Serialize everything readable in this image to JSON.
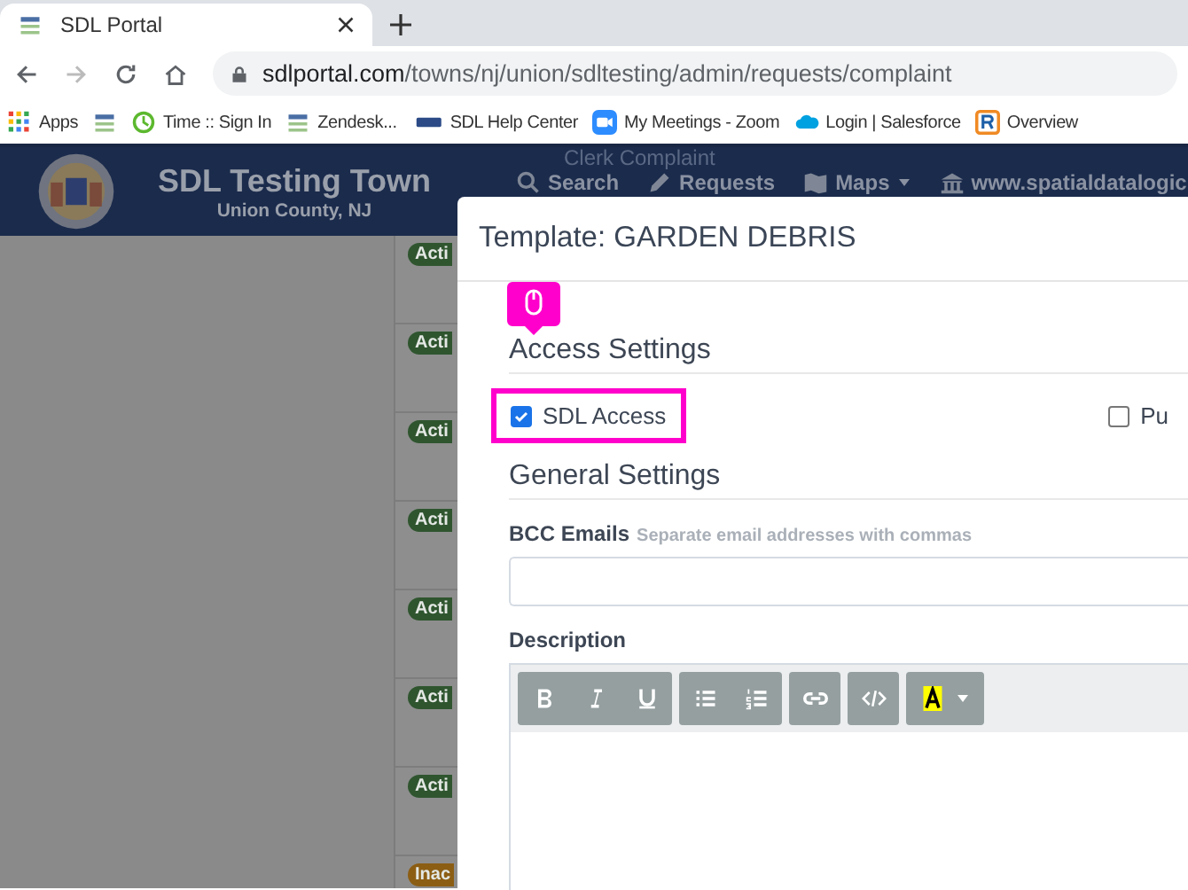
{
  "browser": {
    "tab_title": "SDL Portal",
    "url_domain": "sdlportal.com",
    "url_path": "/towns/nj/union/sdltesting/admin/requests/complaint",
    "bookmarks": [
      {
        "kind": "apps",
        "label": "Apps"
      },
      {
        "kind": "logo"
      },
      {
        "kind": "clock",
        "label": "Time :: Sign In"
      },
      {
        "kind": "logo",
        "label": "Zendesk..."
      },
      {
        "kind": "wordmark",
        "label": "SDL Help Center"
      },
      {
        "kind": "video",
        "label": "My Meetings - Zoom"
      },
      {
        "kind": "cloud",
        "label": "Login | Salesforce"
      },
      {
        "kind": "square",
        "label": "Overview"
      }
    ]
  },
  "site": {
    "title": "SDL Testing Town",
    "subtitle": "Union County, NJ",
    "faint_label": "Clerk Complaint",
    "nav": [
      {
        "kind": "search",
        "label": "Search"
      },
      {
        "kind": "pencil",
        "label": "Requests"
      },
      {
        "kind": "map",
        "label": "Maps",
        "dropdown": true
      },
      {
        "kind": "building",
        "label": "www.spatialdatalogic"
      }
    ],
    "badges": [
      {
        "label": "Acti",
        "color": "#2f552f"
      },
      {
        "label": "Acti",
        "color": "#2f552f"
      },
      {
        "label": "Acti",
        "color": "#2f552f"
      },
      {
        "label": "Acti",
        "color": "#2f552f"
      },
      {
        "label": "Acti",
        "color": "#2f552f"
      },
      {
        "label": "Acti",
        "color": "#2f552f"
      },
      {
        "label": "Acti",
        "color": "#2f552f"
      },
      {
        "label": "Inac",
        "color": "#8c5e14"
      }
    ]
  },
  "modal": {
    "title": "Template: GARDEN DEBRIS",
    "access_heading": "Access Settings",
    "access_options": [
      {
        "label": "SDL Access",
        "checked": true,
        "highlighted": true
      },
      {
        "label": "Pu",
        "checked": false,
        "highlighted": false
      }
    ],
    "general_heading": "General Settings",
    "bcc": {
      "label": "BCC Emails",
      "hint": "Separate email addresses with commas"
    },
    "description_label": "Description",
    "toolbar_groups": [
      [
        {
          "kind": "bold"
        },
        {
          "kind": "italic"
        },
        {
          "kind": "underline"
        }
      ],
      [
        {
          "kind": "bullets"
        },
        {
          "kind": "numbers"
        }
      ],
      [
        {
          "kind": "link"
        }
      ],
      [
        {
          "kind": "code"
        }
      ],
      [
        {
          "kind": "highlight"
        }
      ]
    ]
  }
}
